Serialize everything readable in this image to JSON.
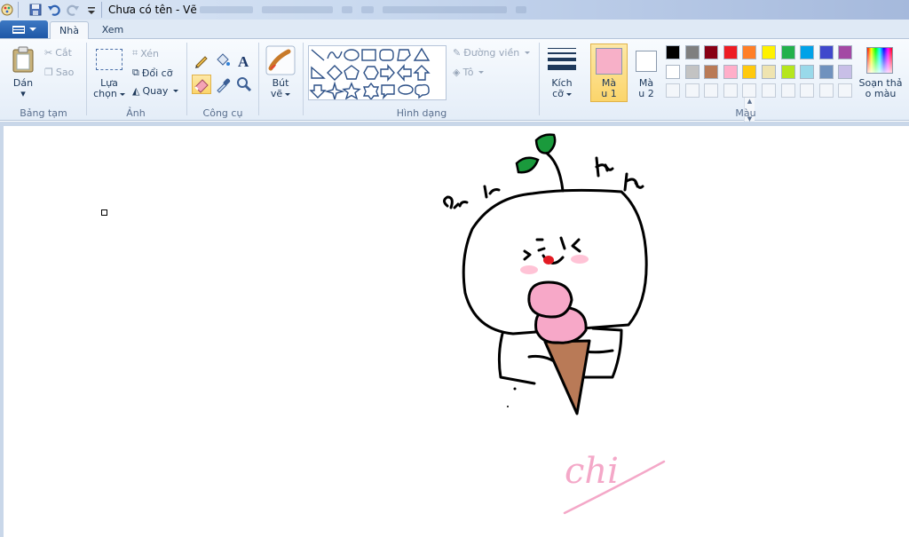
{
  "window": {
    "title": "Chưa có tên - Vẽ"
  },
  "tabs": [
    {
      "label": "Nhà",
      "active": true
    },
    {
      "label": "Xem",
      "active": false
    }
  ],
  "clipboard": {
    "paste_label": "Dán",
    "cut_label": "Cắt",
    "copy_label": "Sao",
    "group_label": "Bảng tạm"
  },
  "image": {
    "select_label_1": "Lựa",
    "select_label_2": "chọn",
    "crop_label": "Xén",
    "resize_label": "Đổi cỡ",
    "rotate_label": "Quay",
    "group_label": "Ảnh"
  },
  "tools": {
    "group_label": "Công cụ"
  },
  "brushes": {
    "label_1": "Bút",
    "label_2": "vẽ"
  },
  "shapes": {
    "outline_label": "Đường viền",
    "fill_label": "Tô",
    "group_label": "Hình dạng"
  },
  "size": {
    "label_1": "Kích",
    "label_2": "cỡ"
  },
  "colors": {
    "color1_label_1": "Mà",
    "color1_label_2": "u 1",
    "color2_label_1": "Mà",
    "color2_label_2": "u 2",
    "color1": "#f7b0c8",
    "color2": "#ffffff",
    "edit_label_1": "Soạn thả",
    "edit_label_2": "o màu",
    "group_label": "Màu",
    "palette_row1": [
      "#000000",
      "#7f7f7f",
      "#880015",
      "#ed1c24",
      "#ff7f27",
      "#fff200",
      "#22b14c",
      "#00a2e8",
      "#3f48cc",
      "#a349a4"
    ],
    "palette_row2": [
      "#ffffff",
      "#c3c3c3",
      "#b97a57",
      "#ffaec9",
      "#ffc90e",
      "#efe4b0",
      "#b5e61d",
      "#99d9ea",
      "#7092be",
      "#c8bfe7"
    ]
  },
  "drawing": {
    "signature_text": "chi"
  }
}
